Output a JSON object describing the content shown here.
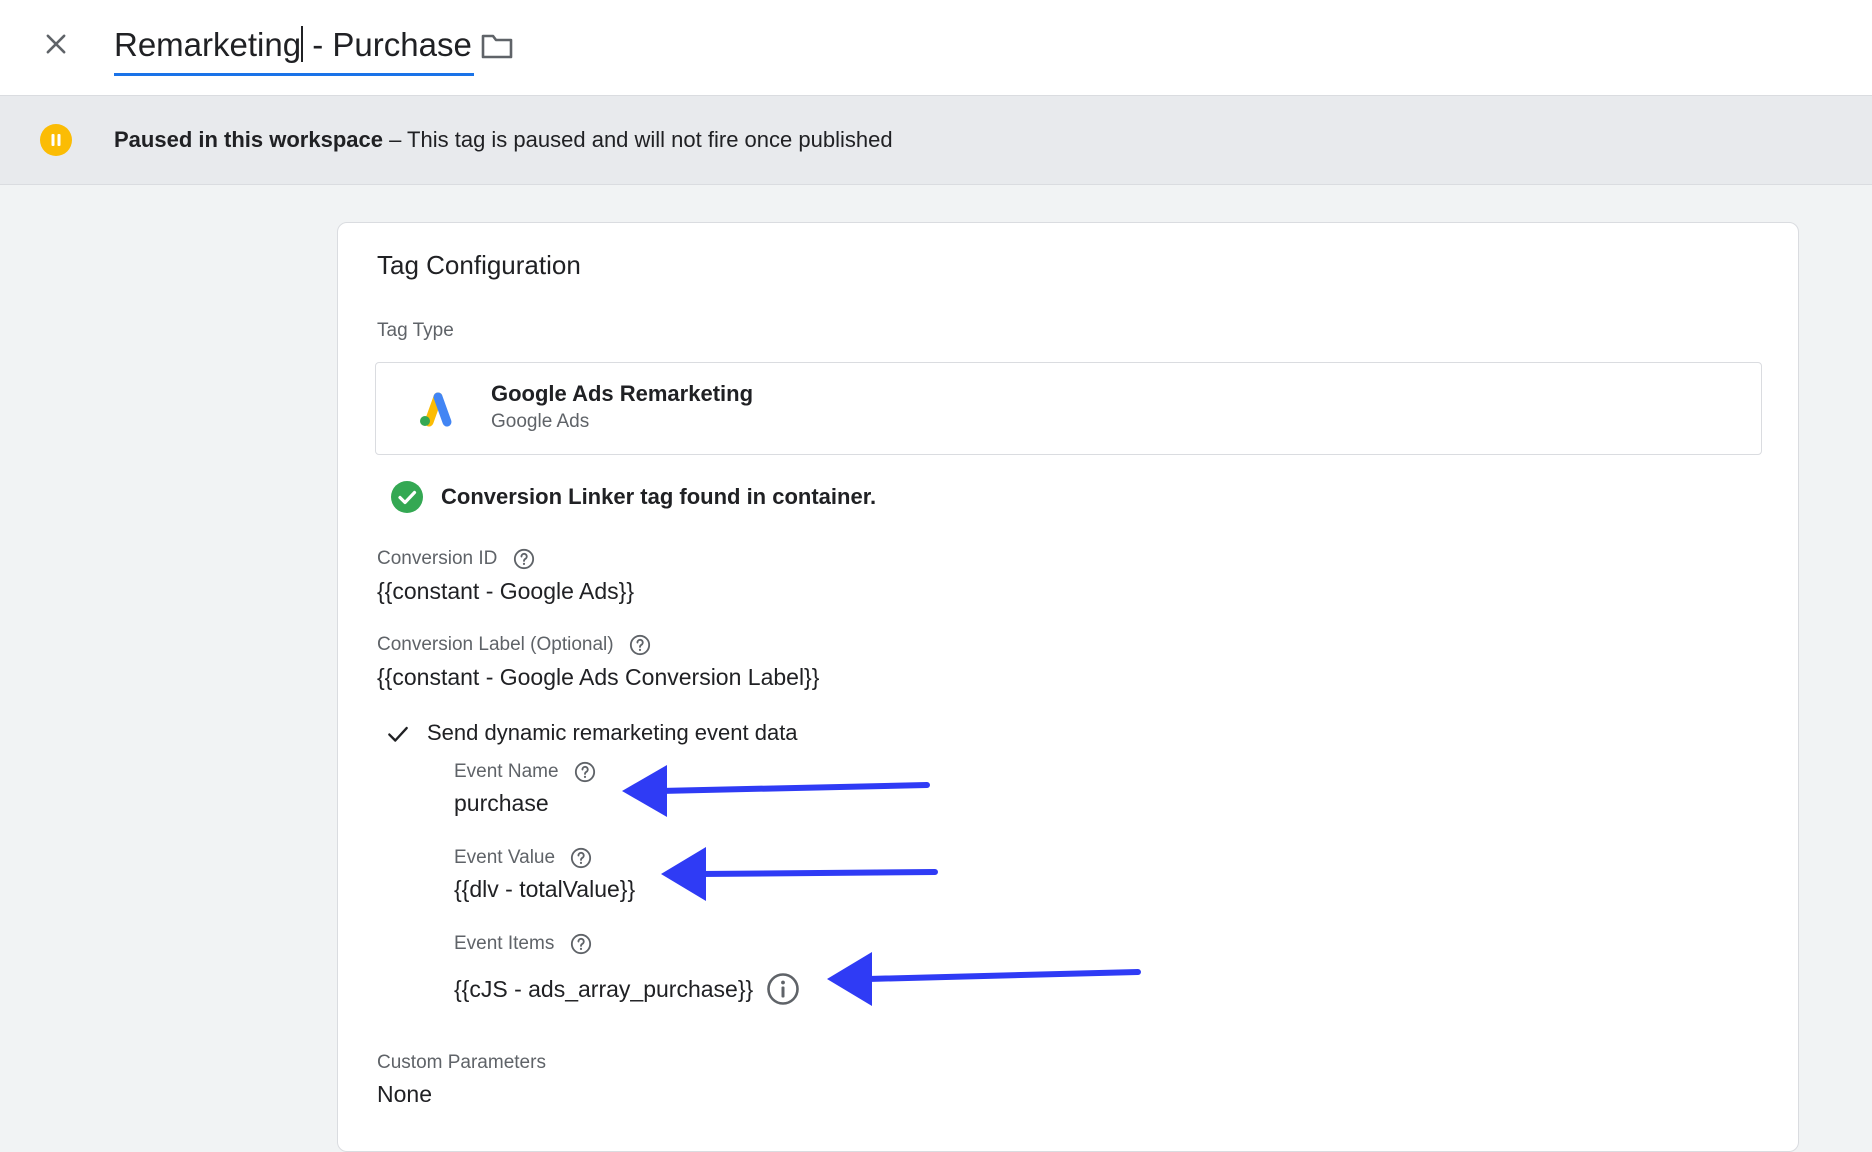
{
  "header": {
    "tag_name_prefix": "Remarketing",
    "tag_name_suffix": " - Purchase"
  },
  "banner": {
    "status": "Paused in this workspace",
    "separator": " – ",
    "message": "This tag is paused and will not fire once published"
  },
  "config": {
    "title": "Tag Configuration",
    "tag_type_label": "Tag Type",
    "tag_type": {
      "name": "Google Ads Remarketing",
      "vendor": "Google Ads"
    },
    "linker_notice": "Conversion Linker tag found in container.",
    "conversion_id": {
      "label": "Conversion ID",
      "value": "{{constant - Google Ads}}"
    },
    "conversion_label": {
      "label": "Conversion Label (Optional)",
      "value": "{{constant - Google Ads Conversion Label}}"
    },
    "dynamic_remarketing": {
      "label": "Send dynamic remarketing event data",
      "event_name": {
        "label": "Event Name",
        "value": "purchase"
      },
      "event_value": {
        "label": "Event Value",
        "value": "{{dlv - totalValue}}"
      },
      "event_items": {
        "label": "Event Items",
        "value": "{{cJS - ads_array_purchase}}"
      }
    },
    "custom_parameters": {
      "label": "Custom Parameters",
      "value": "None"
    }
  },
  "colors": {
    "accent_blue": "#1a73e8",
    "pause_yellow": "#fbbc04",
    "success_green": "#34a853",
    "annotation_arrow": "#2f3bf5"
  },
  "icons": [
    "close-icon",
    "folder-icon",
    "pause-icon",
    "google-ads-logo",
    "check-circle-icon",
    "help-icon",
    "check-icon",
    "info-icon",
    "arrow-annotation"
  ]
}
